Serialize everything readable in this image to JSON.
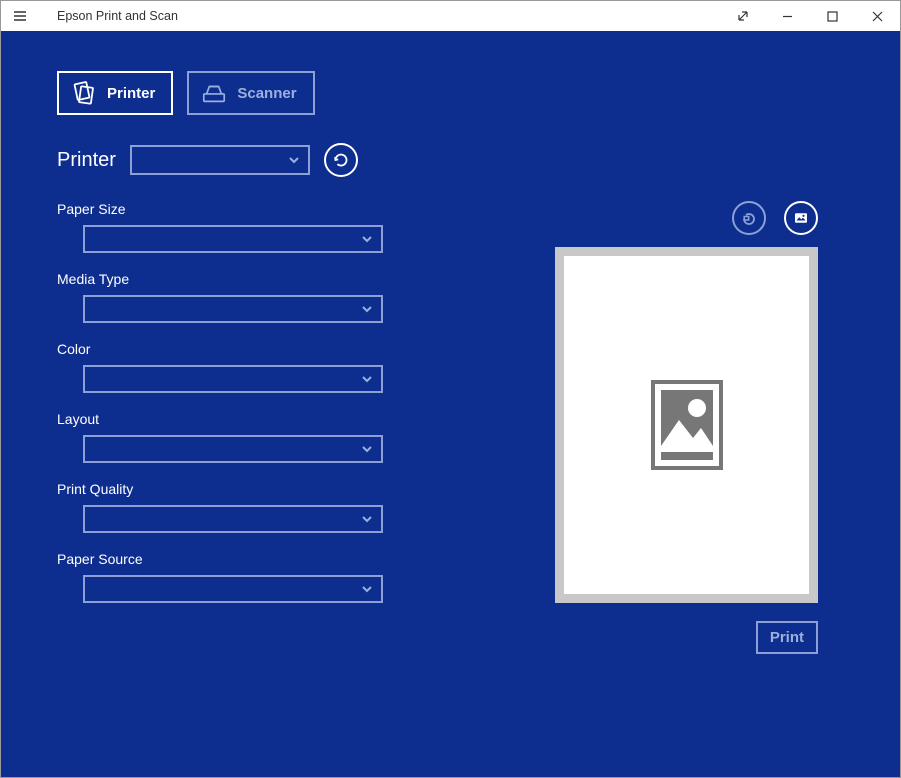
{
  "window": {
    "title": "Epson Print and Scan"
  },
  "tabs": {
    "printer": "Printer",
    "scanner": "Scanner"
  },
  "printerSelect": {
    "label": "Printer",
    "value": ""
  },
  "settings": {
    "paperSize": {
      "label": "Paper Size",
      "value": ""
    },
    "mediaType": {
      "label": "Media Type",
      "value": ""
    },
    "color": {
      "label": "Color",
      "value": ""
    },
    "layout": {
      "label": "Layout",
      "value": ""
    },
    "printQuality": {
      "label": "Print Quality",
      "value": ""
    },
    "paperSource": {
      "label": "Paper Source",
      "value": ""
    }
  },
  "actions": {
    "print": "Print"
  }
}
